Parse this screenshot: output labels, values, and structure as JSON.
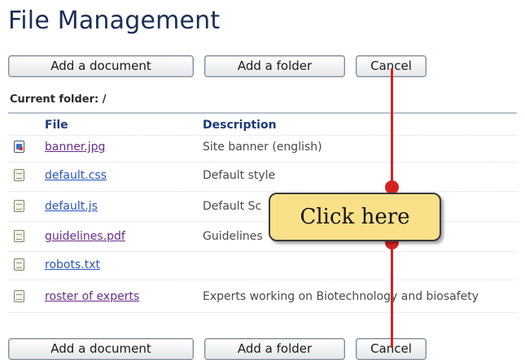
{
  "page": {
    "title": "File Management"
  },
  "toolbar_top": {
    "add_document": "Add a document",
    "add_folder": "Add a folder",
    "cancel": "Cancel"
  },
  "current_folder": "Current folder: /",
  "table": {
    "headers": {
      "file": "File",
      "description": "Description"
    },
    "rows": [
      {
        "name": "banner.jpg",
        "description": "Site banner (english)",
        "icon": "image-file-icon",
        "visited": true
      },
      {
        "name": "default.css",
        "description": "Default style",
        "icon": "document-file-icon",
        "visited": false
      },
      {
        "name": "default.js",
        "description": "Default Sc",
        "icon": "document-file-icon",
        "visited": false
      },
      {
        "name": "guidelines.pdf",
        "description": "Guidelines",
        "icon": "document-file-icon",
        "visited": true
      },
      {
        "name": "robots.txt",
        "description": "",
        "icon": "document-file-icon",
        "visited": false
      },
      {
        "name": "roster of experts",
        "description": "Experts working on Biotechnology and biosafety",
        "icon": "document-file-icon",
        "visited": true
      }
    ]
  },
  "toolbar_bottom": {
    "add_document": "Add a document",
    "add_folder": "Add a folder",
    "cancel": "Cancel"
  },
  "annotation": {
    "text": "Click here",
    "fill": "#fbe08a",
    "pointer_color": "#d42222"
  }
}
